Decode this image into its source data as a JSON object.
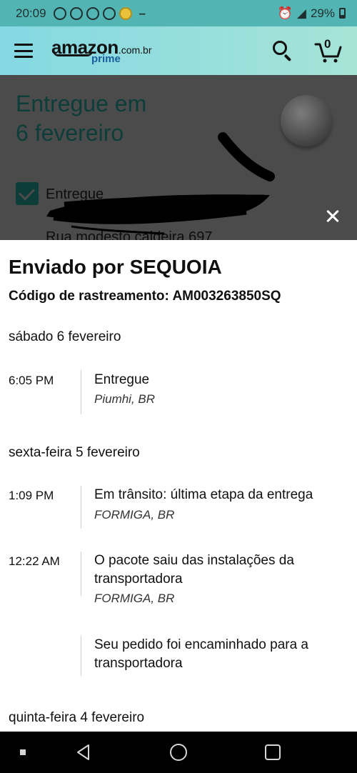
{
  "status_bar": {
    "time": "20:09",
    "dash": "–",
    "battery": "29%",
    "battery_level": 0.29
  },
  "header": {
    "logo_main": "amazon",
    "logo_tld": ".com.br",
    "logo_sub": "prime",
    "cart_count": "0",
    "icons": [
      "menu-icon",
      "search-icon",
      "cart-icon"
    ]
  },
  "background_page": {
    "title_line1": "Entregue em",
    "title_line2": "6 fevereiro",
    "status_label": "Entregue",
    "address": "Rua modesto caldeira 697"
  },
  "sheet": {
    "title": "Enviado por SEQUOIA",
    "tracking_code": "Código de rastreamento: AM003263850SQ",
    "days": [
      {
        "label": "sábado 6 fevereiro",
        "events": [
          {
            "time": "6:05 PM",
            "description": "Entregue",
            "location": "Piumhi, BR"
          }
        ]
      },
      {
        "label": "sexta-feira 5 fevereiro",
        "events": [
          {
            "time": "1:09 PM",
            "description": "Em trânsito: última etapa da entrega",
            "location": "FORMIGA, BR"
          },
          {
            "time": "12:22 AM",
            "description": "O pacote saiu das instalações da transportadora",
            "location": "FORMIGA, BR"
          },
          {
            "time": "",
            "description": "Seu pedido foi encaminhado para a transportadora",
            "location": ""
          }
        ]
      },
      {
        "label": "quinta-feira 4 fevereiro",
        "events": []
      }
    ]
  },
  "colors": {
    "status_bar": "#52b5b3",
    "header_start": "#84d8e3",
    "header_end": "#a6e4d6",
    "overlay": "#4b4b4b",
    "accent_dark_teal": "#0d3d39"
  }
}
